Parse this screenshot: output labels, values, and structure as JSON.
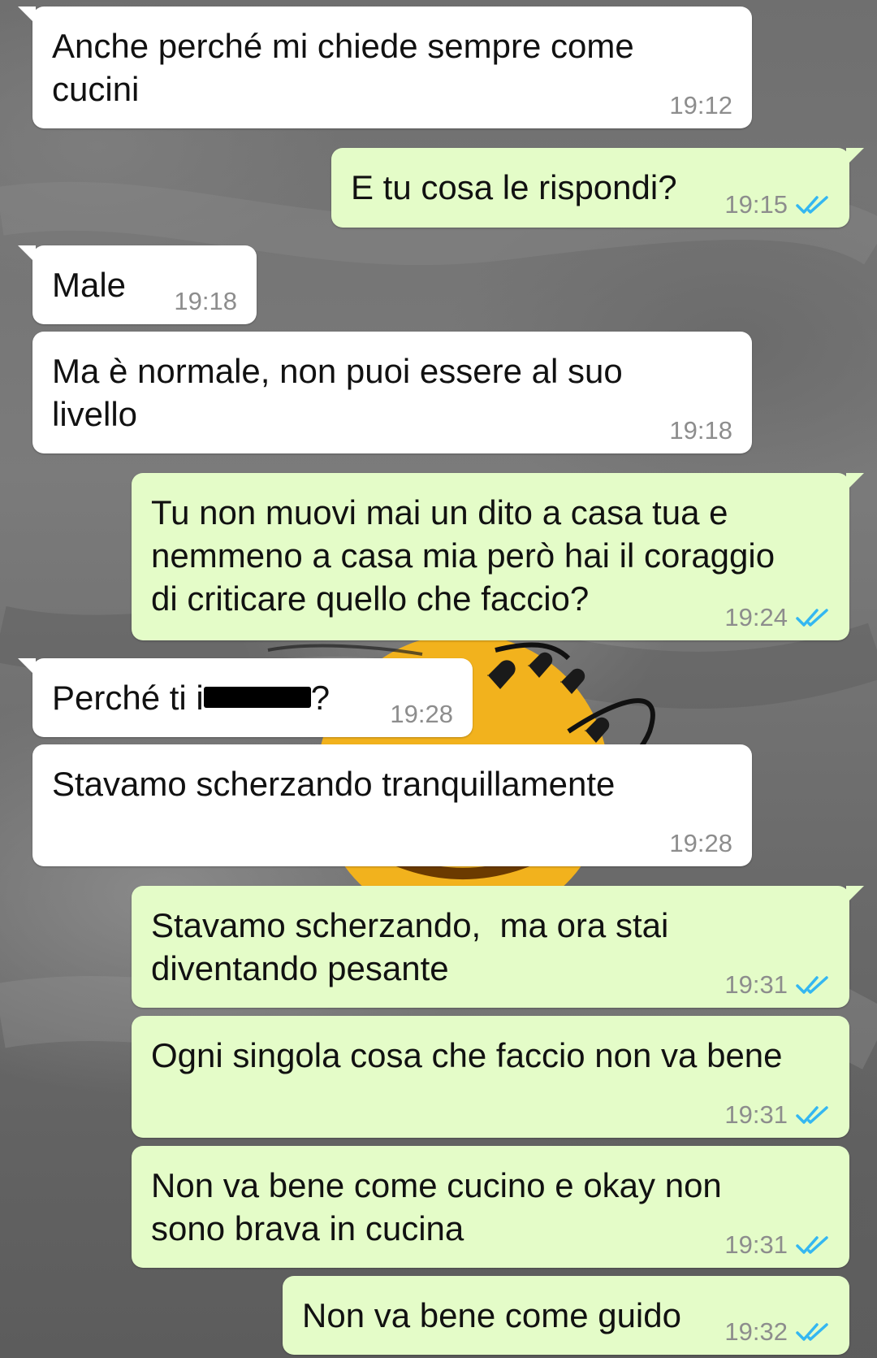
{
  "chat": {
    "messages": [
      {
        "dir": "in",
        "text": "Anche perché mi chiede sempre come\ncucini",
        "time": "19:12",
        "tail": true
      },
      {
        "dir": "out",
        "text": "E tu cosa le rispondi?",
        "time": "19:15",
        "read": true,
        "tail": true
      },
      {
        "dir": "in",
        "text": "Male",
        "time": "19:18",
        "tail": true
      },
      {
        "dir": "in",
        "text": "Ma è normale, non puoi essere al suo\nlivello",
        "time": "19:18",
        "tail": false
      },
      {
        "dir": "out",
        "text": "Tu non muovi mai un dito a casa tua e\nnemmeno a casa mia però hai il coraggio\ndi criticare quello che faccio?",
        "time": "19:24",
        "read": true,
        "tail": true
      },
      {
        "dir": "in",
        "text_before": "Perché ti i",
        "text_after": "?",
        "redacted": true,
        "time": "19:28",
        "tail": true
      },
      {
        "dir": "in",
        "text": "Stavamo scherzando tranquillamente",
        "time": "19:28",
        "tail": false
      },
      {
        "dir": "out",
        "text": "Stavamo scherzando,  ma ora stai\ndiventando pesante",
        "time": "19:31",
        "read": true,
        "tail": true
      },
      {
        "dir": "out",
        "text": "Ogni singola cosa che faccio non va bene",
        "time": "19:31",
        "read": true,
        "tail": false
      },
      {
        "dir": "out",
        "text": "Non va bene come cucino e okay non\nsono brava in cucina",
        "time": "19:31",
        "read": true,
        "tail": false
      },
      {
        "dir": "out",
        "text": "Non va bene come guido",
        "time": "19:32",
        "read": true,
        "tail": false
      }
    ]
  },
  "colors": {
    "incoming_bubble": "#ffffff",
    "outgoing_bubble": "#e4fcc8",
    "timestamp": "#8d8d8d",
    "read_ticks": "#34b7f1"
  },
  "icons": {
    "read_receipt": "double-check-icon",
    "wallpaper_emoji": "smiling-face-icon",
    "wallpaper_hearts": "black-heart-icon"
  }
}
